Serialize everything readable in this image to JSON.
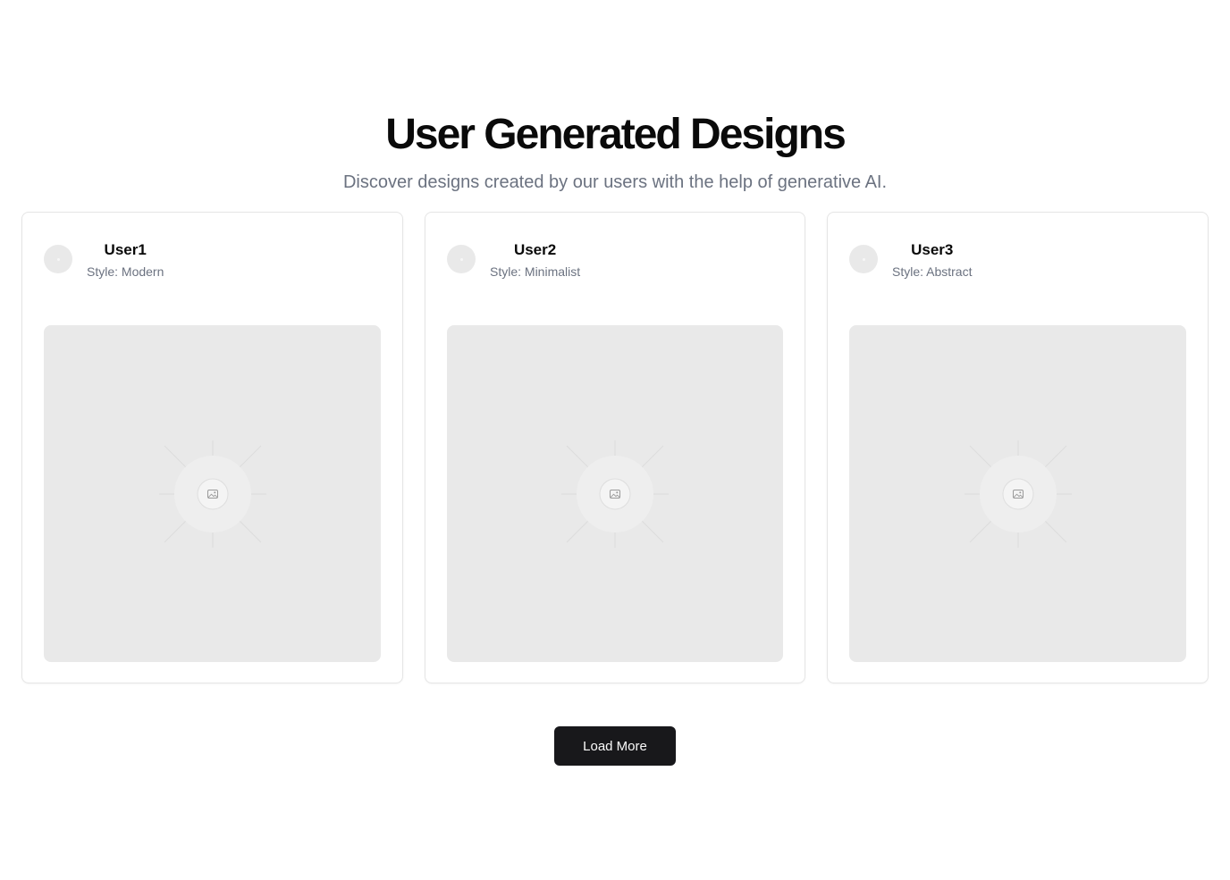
{
  "header": {
    "title": "User Generated Designs",
    "subtitle": "Discover designs created by our users with the help of generative AI."
  },
  "cards": [
    {
      "user": "User1",
      "style": "Style: Modern",
      "avatar_icon": "avatar-placeholder-icon",
      "image_icon": "image-placeholder-icon"
    },
    {
      "user": "User2",
      "style": "Style: Minimalist",
      "avatar_icon": "avatar-placeholder-icon",
      "image_icon": "image-placeholder-icon"
    },
    {
      "user": "User3",
      "style": "Style: Abstract",
      "avatar_icon": "avatar-placeholder-icon",
      "image_icon": "image-placeholder-icon"
    }
  ],
  "actions": {
    "load_more_label": "Load More"
  },
  "colors": {
    "background": "#ffffff",
    "title": "#0a0a0a",
    "muted_text": "#6b7280",
    "card_border": "#e5e5e5",
    "placeholder": "#e9e9e9",
    "button_bg": "#18181b",
    "button_text": "#fafafa"
  }
}
